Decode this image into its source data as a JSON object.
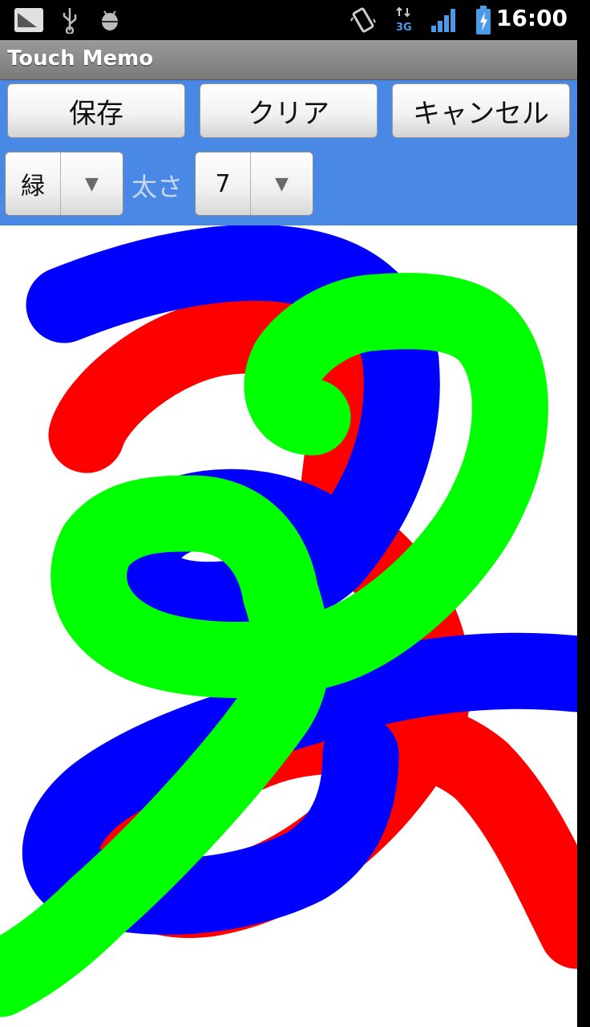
{
  "status_bar": {
    "time": "16:00",
    "icons": [
      "notification-icon",
      "usb-icon",
      "debug-android-icon",
      "vibrate-icon",
      "3g-icon",
      "signal-icon",
      "battery-charging-icon"
    ]
  },
  "app": {
    "title": "Touch Memo"
  },
  "toolbar": {
    "save_label": "保存",
    "clear_label": "クリア",
    "cancel_label": "キャンセル",
    "color_value": "緑",
    "width_label": "太さ",
    "width_value": "7"
  },
  "colors": {
    "toolbar_bg": "#4a88e6",
    "stroke_red": "#ff0000",
    "stroke_blue": "#0000ff",
    "stroke_green": "#00ff00"
  }
}
